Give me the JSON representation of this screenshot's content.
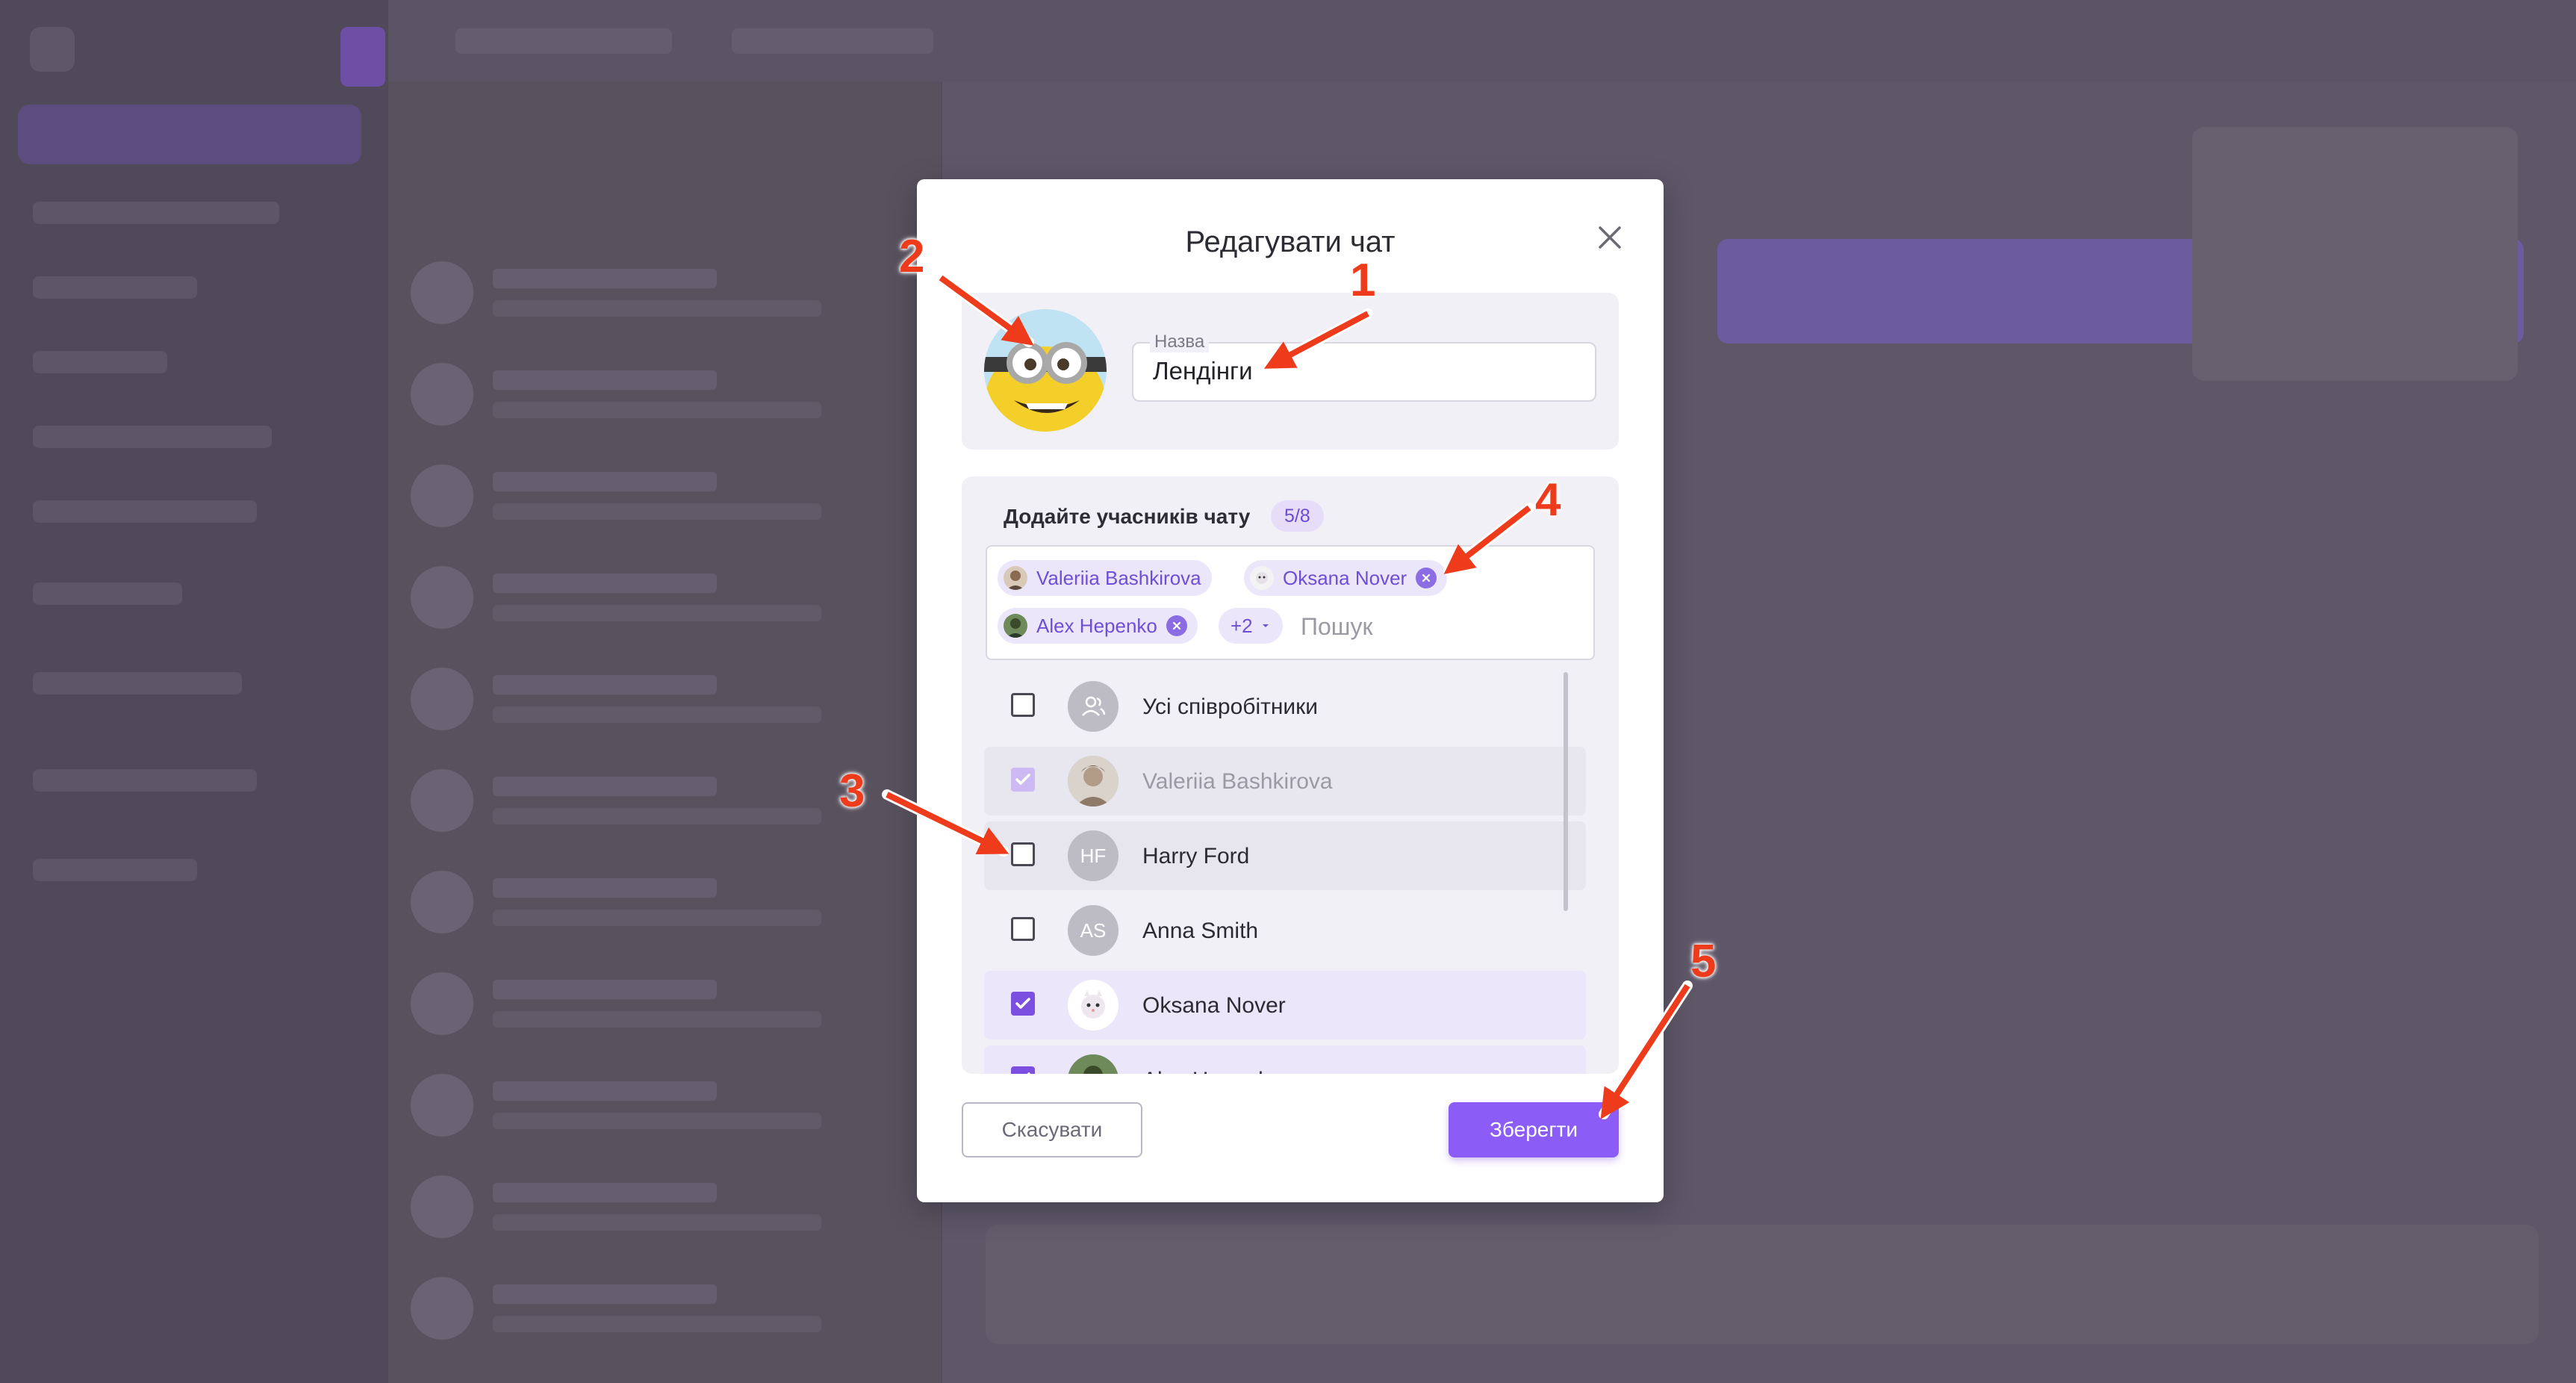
{
  "modal": {
    "title": "Редагувати чат",
    "name_label": "Назва",
    "name_value": "Лендінги",
    "members_title": "Додайте учасників чату",
    "members_count": "5/8",
    "search_placeholder": "Пошук",
    "more_chip": "+2",
    "cancel_label": "Скасувати",
    "save_label": "Зберегти"
  },
  "chips": [
    {
      "name": "Valeriia Bashkirova",
      "removable": false
    },
    {
      "name": "Oksana Nover",
      "removable": true
    },
    {
      "name": "Alex Hepenko",
      "removable": true
    }
  ],
  "members": [
    {
      "name": "Усі співробітники",
      "initials": "",
      "state": "unchecked"
    },
    {
      "name": "Valeriia Bashkirova",
      "initials": "",
      "state": "disabled-checked"
    },
    {
      "name": "Harry Ford",
      "initials": "HF",
      "state": "unchecked"
    },
    {
      "name": "Anna Smith",
      "initials": "AS",
      "state": "unchecked"
    },
    {
      "name": "Oksana Nover",
      "initials": "",
      "state": "checked"
    },
    {
      "name": "Alex Hepenko",
      "initials": "",
      "state": "checked"
    }
  ],
  "annotations": [
    "1",
    "2",
    "3",
    "4",
    "5"
  ],
  "colors": {
    "accent": "#8b5cf6",
    "chip_bg": "#ece6fb",
    "annotation_red": "#ee3b1c",
    "overlay": "#5b5566"
  }
}
